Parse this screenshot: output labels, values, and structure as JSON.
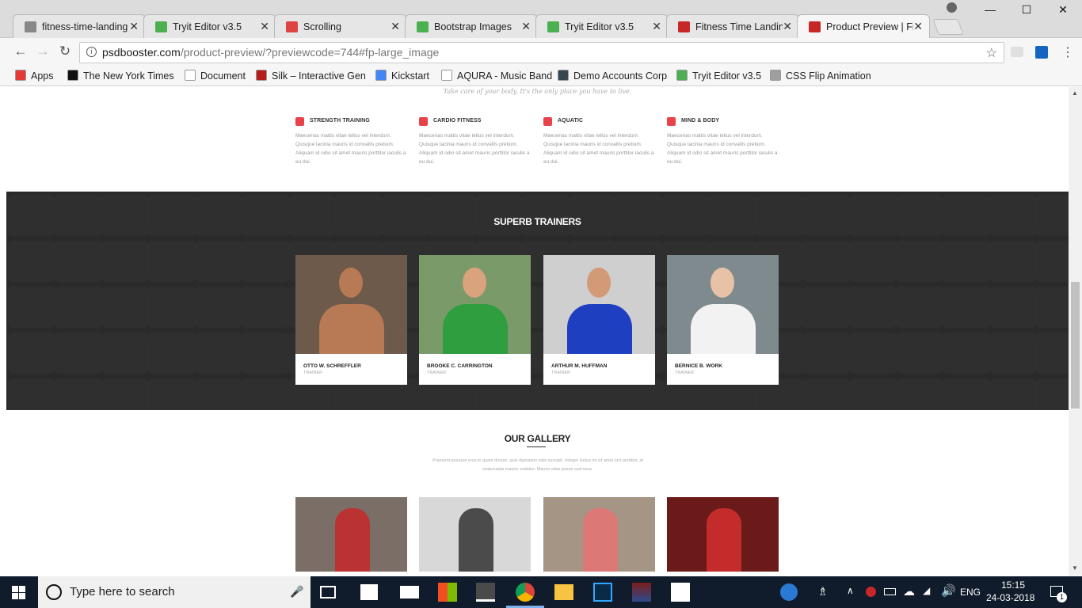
{
  "browser": {
    "tabs": [
      {
        "title": "fitness-time-landing",
        "color": "#888888",
        "active": false
      },
      {
        "title": "Tryit Editor v3.5",
        "color": "#4caf50",
        "active": false
      },
      {
        "title": "Scrolling",
        "color": "#d44",
        "active": false
      },
      {
        "title": "Bootstrap Images",
        "color": "#4caf50",
        "active": false
      },
      {
        "title": "Tryit Editor v3.5",
        "color": "#4caf50",
        "active": false
      },
      {
        "title": "Fitness Time Landin",
        "color": "#c62828",
        "active": false
      },
      {
        "title": "Product Preview | Fi",
        "color": "#c62828",
        "active": true
      }
    ],
    "url_host": "psdbooster.com",
    "url_path": "/product-preview/?previewcode=744#fp-large_image",
    "bookmarks": [
      {
        "label": "Apps",
        "icon": "apps-grid-icon",
        "color": "#e53935"
      },
      {
        "label": "The New York Times",
        "icon": "nyt-icon",
        "color": "#111111"
      },
      {
        "label": "Document",
        "icon": "page-icon",
        "color": "#ffffff"
      },
      {
        "label": "Silk – Interactive Gen",
        "icon": "silk-icon",
        "color": "#b71c1c"
      },
      {
        "label": "Kickstart",
        "icon": "google-icon",
        "color": "#4285f4"
      },
      {
        "label": "AQURA - Music Band",
        "icon": "page-icon",
        "color": "#ffffff"
      },
      {
        "label": "Demo Accounts Corp",
        "icon": "w3-icon",
        "color": "#37474f"
      },
      {
        "label": "Tryit Editor v3.5",
        "icon": "w3-green-icon",
        "color": "#4caf50"
      },
      {
        "label": "CSS Flip Animation",
        "icon": "flip-icon",
        "color": "#9e9e9e"
      }
    ]
  },
  "page": {
    "tagline": "Take care of your body. It's the only place you have to live.",
    "features": [
      {
        "title": "STRENGTH TRAINING",
        "desc": "Maecenas mattis vitae tellus vel interdum. Quisque lacinia mauris id convallis pretium. Aliquam id odio sit amet mauris porttitor iaculis a eu dui."
      },
      {
        "title": "CARDIO FITNESS",
        "desc": "Maecenas mattis vitae tellus vel interdum. Quisque lacinia mauris id convallis pretium. Aliquam id odio sit amet mauris porttitor iaculis a eu dui."
      },
      {
        "title": "AQUATIC",
        "desc": "Maecenas mattis vitae tellus vel interdum. Quisque lacinia mauris id convallis pretium. Aliquam id odio sit amet mauris porttitor iaculis a eu dui."
      },
      {
        "title": "MIND & BODY",
        "desc": "Maecenas mattis vitae tellus vel interdum. Quisque lacinia mauris id convallis pretium. Aliquam id odio sit amet mauris porttitor iaculis a eu dui."
      }
    ],
    "trainers_title": "SUPERB TRAINERS",
    "trainers": [
      {
        "name": "OTTO W. SCHREFFLER",
        "role": "TRAINER",
        "bg": "#6d5a4a",
        "skin": "#b77a55",
        "shirt": "#b77a55"
      },
      {
        "name": "BROOKE C. CARRINGTON",
        "role": "TRAINER",
        "bg": "#7a9a6a",
        "skin": "#d9a37e",
        "shirt": "#2e9e3e"
      },
      {
        "name": "ARTHUR M. HUFFMAN",
        "role": "TRAINER",
        "bg": "#cfcfcf",
        "skin": "#d39a78",
        "shirt": "#1e3fbf"
      },
      {
        "name": "BERNICE B. WORK",
        "role": "TRAINER",
        "bg": "#7e8a8e",
        "skin": "#e8c2a6",
        "shirt": "#f2f2f2"
      }
    ],
    "gallery_title": "OUR GALLERY",
    "gallery_desc": "Praesent posuere eros in quam dictum, quis dignissim odio suscipit. Integer luctus mi sit amet orci porttitor, at malesuada mauris sodales. Mauris vitae ipsum sed risus.",
    "gallery": [
      {
        "bg": "#7b6e66",
        "accent": "#c62828"
      },
      {
        "bg": "#d8d8d8",
        "accent": "#333333"
      },
      {
        "bg": "#a59584",
        "accent": "#e57373"
      },
      {
        "bg": "#6b1a1a",
        "accent": "#d32f2f"
      }
    ]
  },
  "taskbar": {
    "search_placeholder": "Type here to search",
    "time": "15:15",
    "date": "24-03-2018",
    "lang": "ENG",
    "notif_count": "1"
  }
}
